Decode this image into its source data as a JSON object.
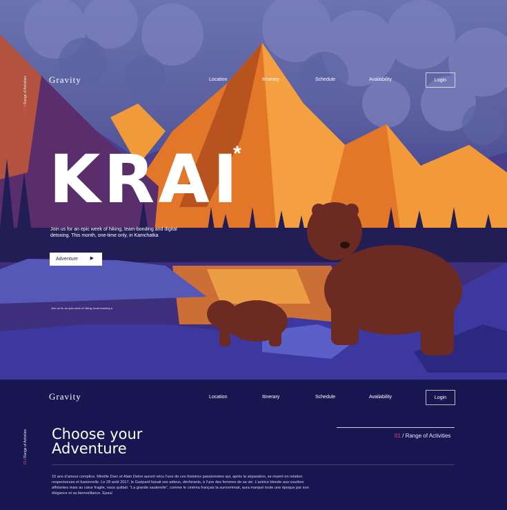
{
  "hero": {
    "brand": "Gravity",
    "nav": [
      "Location",
      "Itinerary",
      "Schedule",
      "Availability"
    ],
    "login": "Login",
    "side_label_num": "01",
    "side_label_text": " / Range of Activities",
    "title": "KRAI",
    "title_mark": "*",
    "lead": "Join us for an epic week of hiking, team-bonding and digital detoxing. This month, one-time only, in Kamchatka",
    "cta_label": "Adventure",
    "cta_icon": "play-icon",
    "small_note": "Join us for an epic week of hiking, team-bonding a"
  },
  "lower": {
    "brand": "Gravity",
    "nav": [
      "Location",
      "Itinerary",
      "Schedule",
      "Availability"
    ],
    "login": "Login",
    "side_label_num": "01",
    "side_label_text": " / Range of Activities",
    "heading_line1": "Choose your",
    "heading_line2": "Adventure",
    "range_num": "01",
    "range_text": " / Range of Activities",
    "paragraph": "15 ans d’amour complice. Mireille Darc et Alain Delon auront vécu l’une de ces histoires passionnées qui, après la séparation, se muent en relation respectueuse et fusionnelle. Le 28 août 2017, le Guépard faisait ses adieux, déchirants, à l’une des femmes de sa vie. L’actrice blonde aux courbes affolantes mais au cœur fragile, nous quittait. “La grande sauterelle”, comme le cinéma français la surnommait, aura marqué toute une époque par son élégance et sa bienveillance. Epaul"
  },
  "colors": {
    "accent": "#ff3b57",
    "navy": "#171650",
    "mountain_orange": "#f08b2c"
  }
}
